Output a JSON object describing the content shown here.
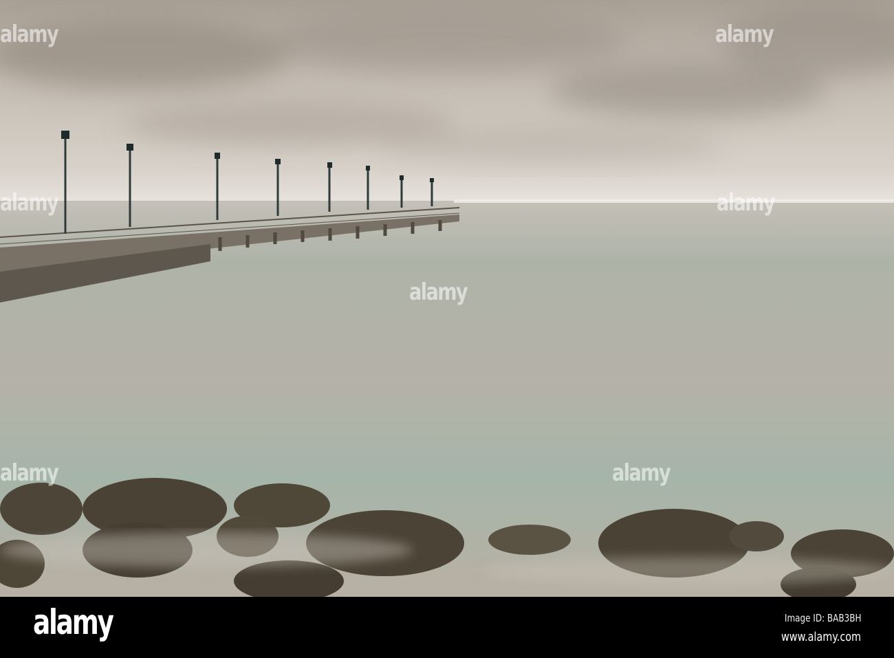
{
  "photo": {
    "subject": "pier-over-calm-sea",
    "watermark": "alamy",
    "colors": {
      "sky": "#c9c0b6",
      "horizon": "#e6e2dc",
      "sea": "#b9b3a9",
      "sea_green": "#a7b6aa",
      "rock": "#4a4234",
      "pier": "#6e655a"
    }
  },
  "footer": {
    "logo": "alamy",
    "image_id": "Image ID: BAB3BH",
    "website": "www.alamy.com"
  }
}
